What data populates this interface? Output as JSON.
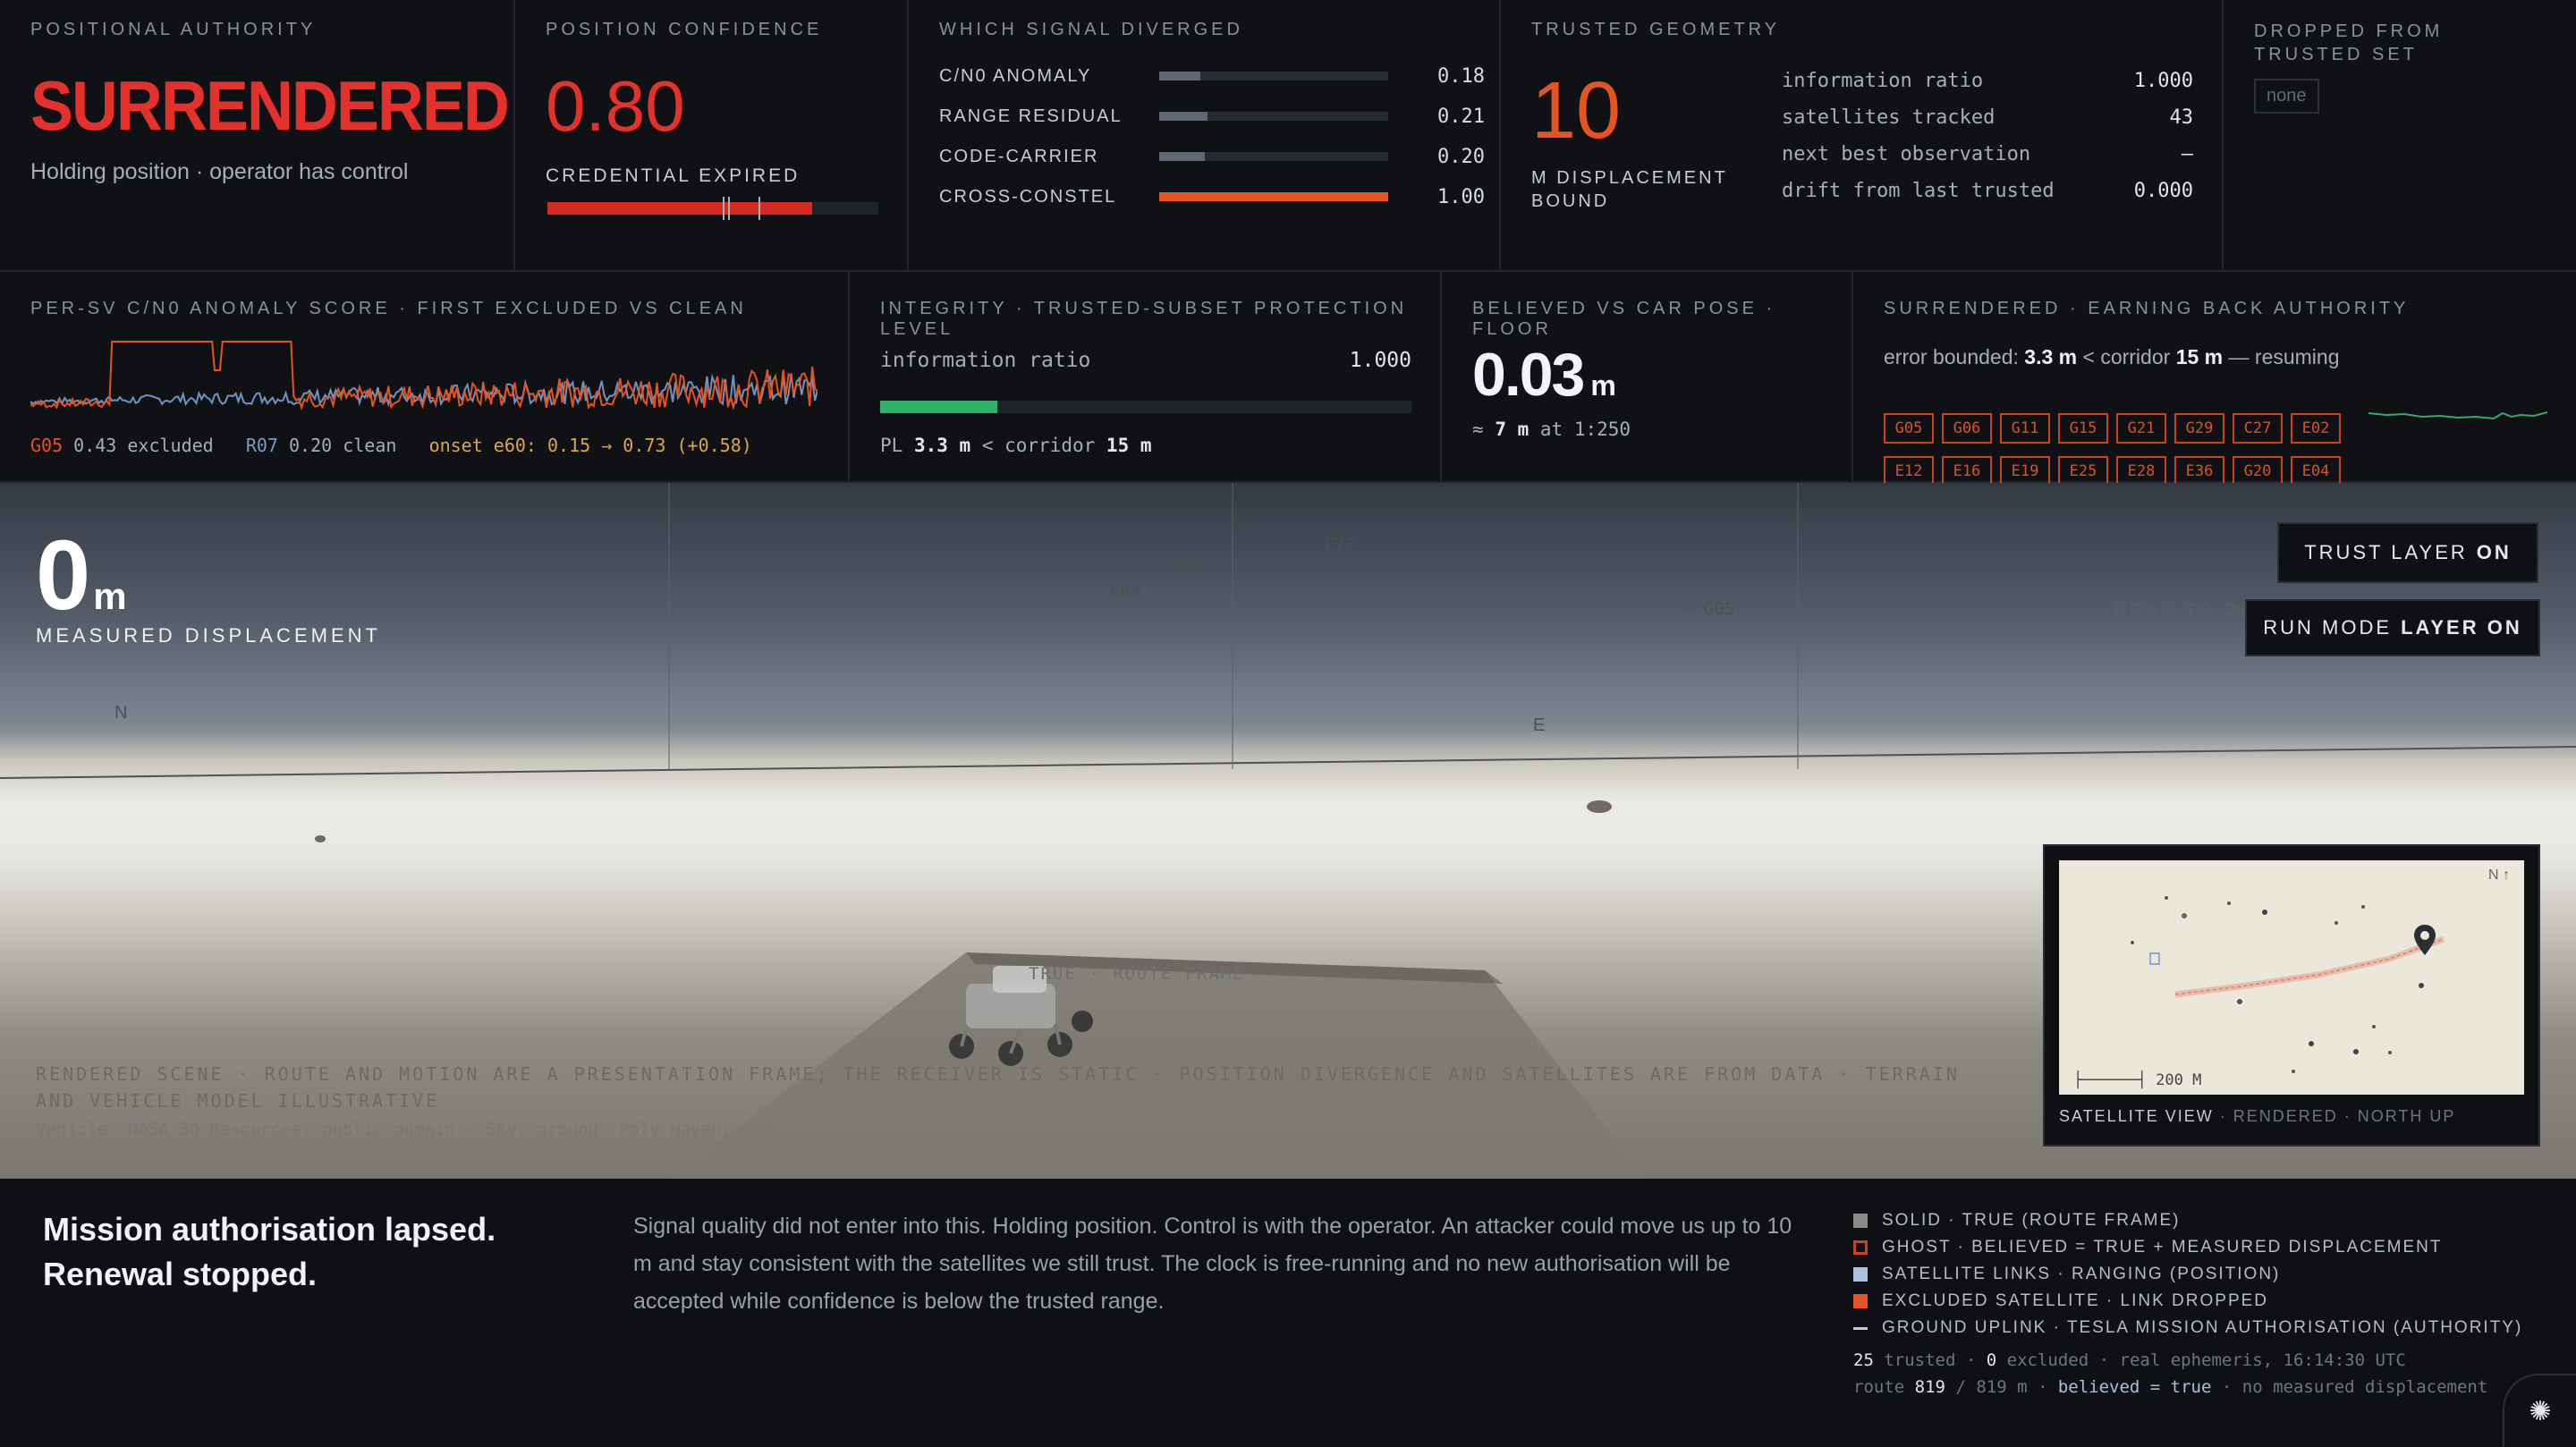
{
  "authority": {
    "label": "POSITIONAL AUTHORITY",
    "value": "SURRENDERED",
    "subtitle": "Holding position · operator has control"
  },
  "confidence": {
    "label": "POSITION CONFIDENCE",
    "value": "0.80",
    "subtitle": "CREDENTIAL EXPIRED",
    "fill": 0.8
  },
  "signal": {
    "label": "WHICH SIGNAL DIVERGED",
    "rows": [
      {
        "name": "C/N0 ANOMALY",
        "value": "0.18",
        "fill": 0.18,
        "color": "#5f6772"
      },
      {
        "name": "RANGE RESIDUAL",
        "value": "0.21",
        "fill": 0.21,
        "color": "#5f6772"
      },
      {
        "name": "CODE-CARRIER",
        "value": "0.20",
        "fill": 0.2,
        "color": "#5f6772"
      },
      {
        "name": "CROSS-CONSTEL",
        "value": "1.00",
        "fill": 1.0,
        "color": "#e5541f"
      }
    ]
  },
  "geometry": {
    "label": "TRUSTED GEOMETRY",
    "value": "10",
    "subtitle": "M DISPLACEMENT BOUND",
    "rows": [
      {
        "key": "information ratio",
        "value": "1.000"
      },
      {
        "key": "satellites tracked",
        "value": "43"
      },
      {
        "key": "next best observation",
        "value": "–"
      },
      {
        "key": "drift from last trusted",
        "value": "0.000"
      }
    ]
  },
  "dropped": {
    "label": "DROPPED FROM TRUSTED SET",
    "chip": "none"
  },
  "per_sv": {
    "label": "PER-SV C/N0 ANOMALY SCORE · FIRST EXCLUDED VS CLEAN",
    "excluded_sv": "G05",
    "excluded_val": "0.43 excluded",
    "clean_sv": "R07",
    "clean_val": "0.20 clean",
    "onset": "onset e60: 0.15 → 0.73 (+0.58)"
  },
  "integrity": {
    "label": "INTEGRITY · TRUSTED-SUBSET PROTECTION LEVEL",
    "row_key": "information ratio",
    "row_value": "1.000",
    "fill": 0.22,
    "pl_prefix": "PL",
    "pl_value": "3.3 m",
    "pl_mid": "< corridor",
    "pl_corridor": "15 m"
  },
  "pose": {
    "label": "BELIEVED VS CAR POSE · FLOOR",
    "value": "0.03",
    "unit": "m",
    "sub_prefix": "≈",
    "sub_value": "7 m",
    "sub_suffix": "at 1:250"
  },
  "earn": {
    "label": "SURRENDERED · EARNING BACK AUTHORITY",
    "text_a": "error bounded: ",
    "bound": "3.3 m",
    "text_b": " < corridor ",
    "corridor": "15 m",
    "text_c": " — resuming",
    "chips": [
      "G05",
      "G06",
      "G11",
      "G15",
      "G21",
      "G29",
      "C27",
      "E02",
      "E12",
      "E16",
      "E19",
      "E25",
      "E28",
      "E36",
      "G20",
      "E04"
    ]
  },
  "scene": {
    "disp_value": "0",
    "disp_unit": "m",
    "disp_label": "MEASURED DISPLACEMENT",
    "trust_btn": "TRUST LAYER",
    "trust_state": "ON",
    "run_btn": "RUN MODE",
    "run_state": "LAYER ON",
    "orbit_hint": "DRAG TO ORBIT · PRESS R TO RESET",
    "route_tag": "TRUE · ROUTE FRAME",
    "note": "RENDERED SCENE · ROUTE AND MOTION ARE A PRESENTATION FRAME; THE RECEIVER IS STATIC · POSITION DIVERGENCE AND SATELLITES ARE FROM DATA · TERRAIN AND VEHICLE MODEL ILLUSTRATIVE",
    "credit": "Vehicle: NASA 3D Resources, public domain · Sky, ground: Poly Haven, CC0",
    "satellites": [
      "G20",
      "E04",
      "C27",
      "G05"
    ],
    "compass_n": "N",
    "compass_e": "E"
  },
  "minimap": {
    "caption_a": "SATELLITE VIEW",
    "caption_b": " · RENDERED · NORTH UP",
    "scale": "200 M",
    "north": "N ↑"
  },
  "bottom": {
    "title": "Mission authorisation lapsed. Renewal stopped.",
    "body": "Signal quality did not enter into this. Holding position. Control is with the operator. An attacker could move us up to 10 m and stay consistent with the satellites we still trust. The clock is free-running and no new authorisation will be accepted while confidence is below the trusted range."
  },
  "legend": {
    "items": [
      {
        "text": "SOLID · TRUE (ROUTE FRAME)",
        "color": "#8a8a8a"
      },
      {
        "text": "GHOST · BELIEVED = TRUE + MEASURED DISPLACEMENT",
        "color": "#c8441c"
      },
      {
        "text": "SATELLITE LINKS · RANGING (POSITION)",
        "color": "#a9c0e0"
      },
      {
        "text": "EXCLUDED SATELLITE · LINK DROPPED",
        "color": "#e5541f"
      },
      {
        "text": "GROUND UPLINK · TESLA MISSION AUTHORISATION (AUTHORITY)",
        "color": "#c9ccd2"
      }
    ],
    "trusted_n": "25",
    "trusted_txt": "trusted",
    "excluded_n": "0",
    "excluded_txt": "excluded",
    "ephem": "real ephemeris, 16:14:30 UTC",
    "route_txt": "route",
    "route_n": "819",
    "route_total": "/ 819 m",
    "believed": "believed = true",
    "nomeas": "no measured displacement"
  }
}
